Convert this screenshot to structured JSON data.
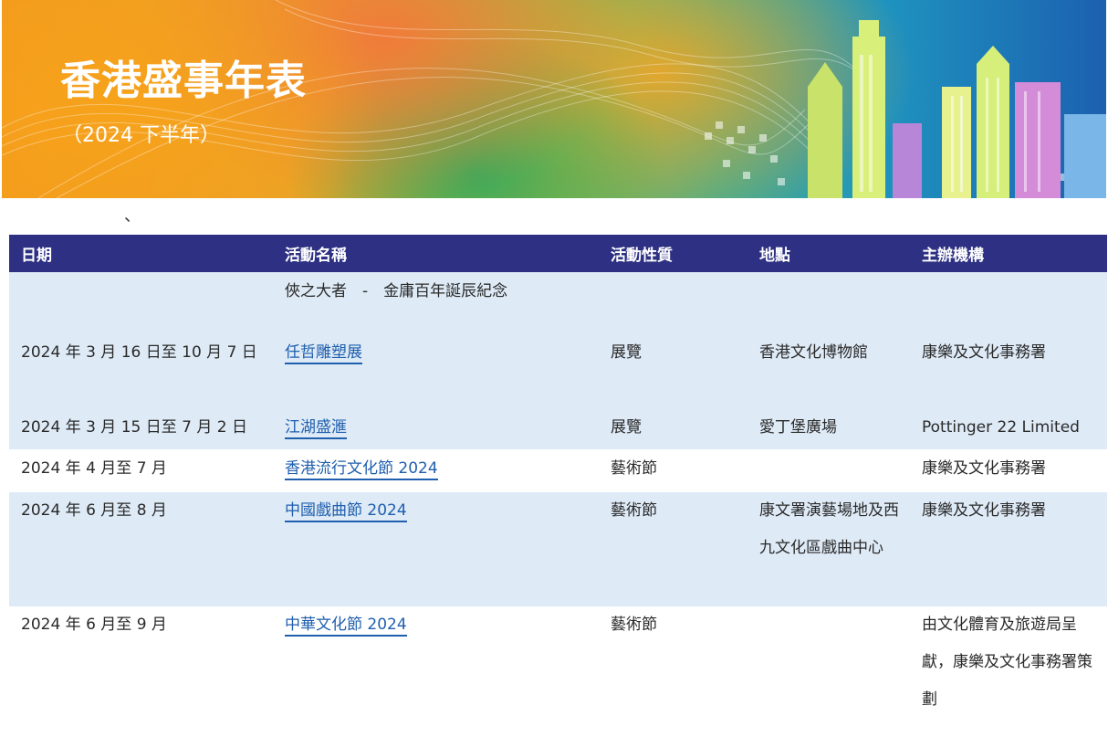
{
  "banner": {
    "title": "香港盛事年表",
    "subtitle": "（2024 下半年）"
  },
  "stray_mark": "、",
  "table": {
    "headers": [
      "日期",
      "活動名稱",
      "活動性質",
      "地點",
      "主辦機構"
    ],
    "prefix_row": {
      "name_prefix": "俠之大者　-　金庸百年誕辰紀念"
    },
    "rows": [
      {
        "date": "2024 年 3 月 16 日至 10 月 7 日",
        "name": "任哲雕塑展",
        "type": "展覽",
        "venue": "香港文化博物館",
        "organizer": "康樂及文化事務署"
      },
      {
        "date": "2024 年 3 月 15 日至 7 月 2 日",
        "name": "江湖盛滙",
        "type": "展覽",
        "venue": "愛丁堡廣場",
        "organizer": "Pottinger 22 Limited"
      },
      {
        "date": "2024 年 4 月至 7 月",
        "name": "香港流行文化節 2024",
        "type": "藝術節",
        "venue": "",
        "organizer": "康樂及文化事務署"
      },
      {
        "date": "2024 年 6 月至 8 月",
        "name": "中國戲曲節 2024",
        "type": "藝術節",
        "venue": "康文署演藝場地及西九文化區戲曲中心",
        "organizer": "康樂及文化事務署"
      },
      {
        "date": "2024 年 6 月至 9 月",
        "name": "中華文化節 2024",
        "type": "藝術節",
        "venue": "",
        "organizer": "由文化體育及旅遊局呈獻，康樂及文化事務署策劃"
      }
    ]
  },
  "colors": {
    "header_bg": "#2e3183",
    "row_blue": "#deeaf6",
    "link": "#1f5fae"
  }
}
